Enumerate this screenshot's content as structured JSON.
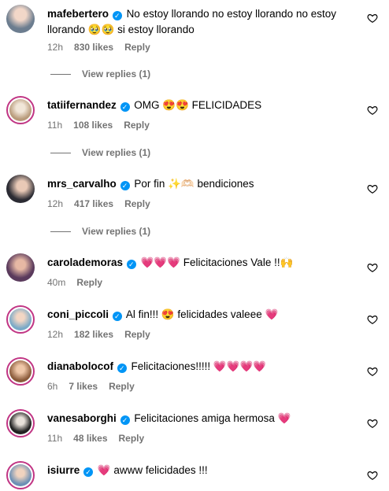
{
  "comments": [
    {
      "username": "mafebertero",
      "text": "No estoy llorando no estoy llorando no estoy llorando 🥹🥹 si estoy llorando",
      "time": "12h",
      "likes": "830 likes",
      "reply": "Reply",
      "view_replies": "View replies (1)"
    },
    {
      "username": "tatiifernandez",
      "text": "OMG 😍😍 FELICIDADES",
      "time": "11h",
      "likes": "108 likes",
      "reply": "Reply",
      "view_replies": "View replies (1)"
    },
    {
      "username": "mrs_carvalho",
      "text": "Por fin ✨🫶🏻 bendiciones",
      "time": "12h",
      "likes": "417 likes",
      "reply": "Reply",
      "view_replies": "View replies (1)"
    },
    {
      "username": "carolademoras",
      "text": "💗💗💗 Felicitaciones Vale !!🙌",
      "time": "40m",
      "likes": "",
      "reply": "Reply"
    },
    {
      "username": "coni_piccoli",
      "text": "Al fin!!! 😍 felicidades valeee 💗",
      "time": "12h",
      "likes": "182 likes",
      "reply": "Reply"
    },
    {
      "username": "dianabolocof",
      "text": "Felicitaciones!!!!! 💗💗💗💗",
      "time": "6h",
      "likes": "7 likes",
      "reply": "Reply"
    },
    {
      "username": "vanesaborghi",
      "text": "Felicitaciones amiga hermosa 💗",
      "time": "11h",
      "likes": "48 likes",
      "reply": "Reply"
    },
    {
      "username": "isiurre",
      "text": "💗 awww felicidades !!!",
      "time": "",
      "likes": "",
      "reply": ""
    }
  ],
  "colors": {
    "accent": "#0095f6",
    "ring": "#c13584",
    "heart": "#ed1c6c",
    "muted": "#737373"
  }
}
